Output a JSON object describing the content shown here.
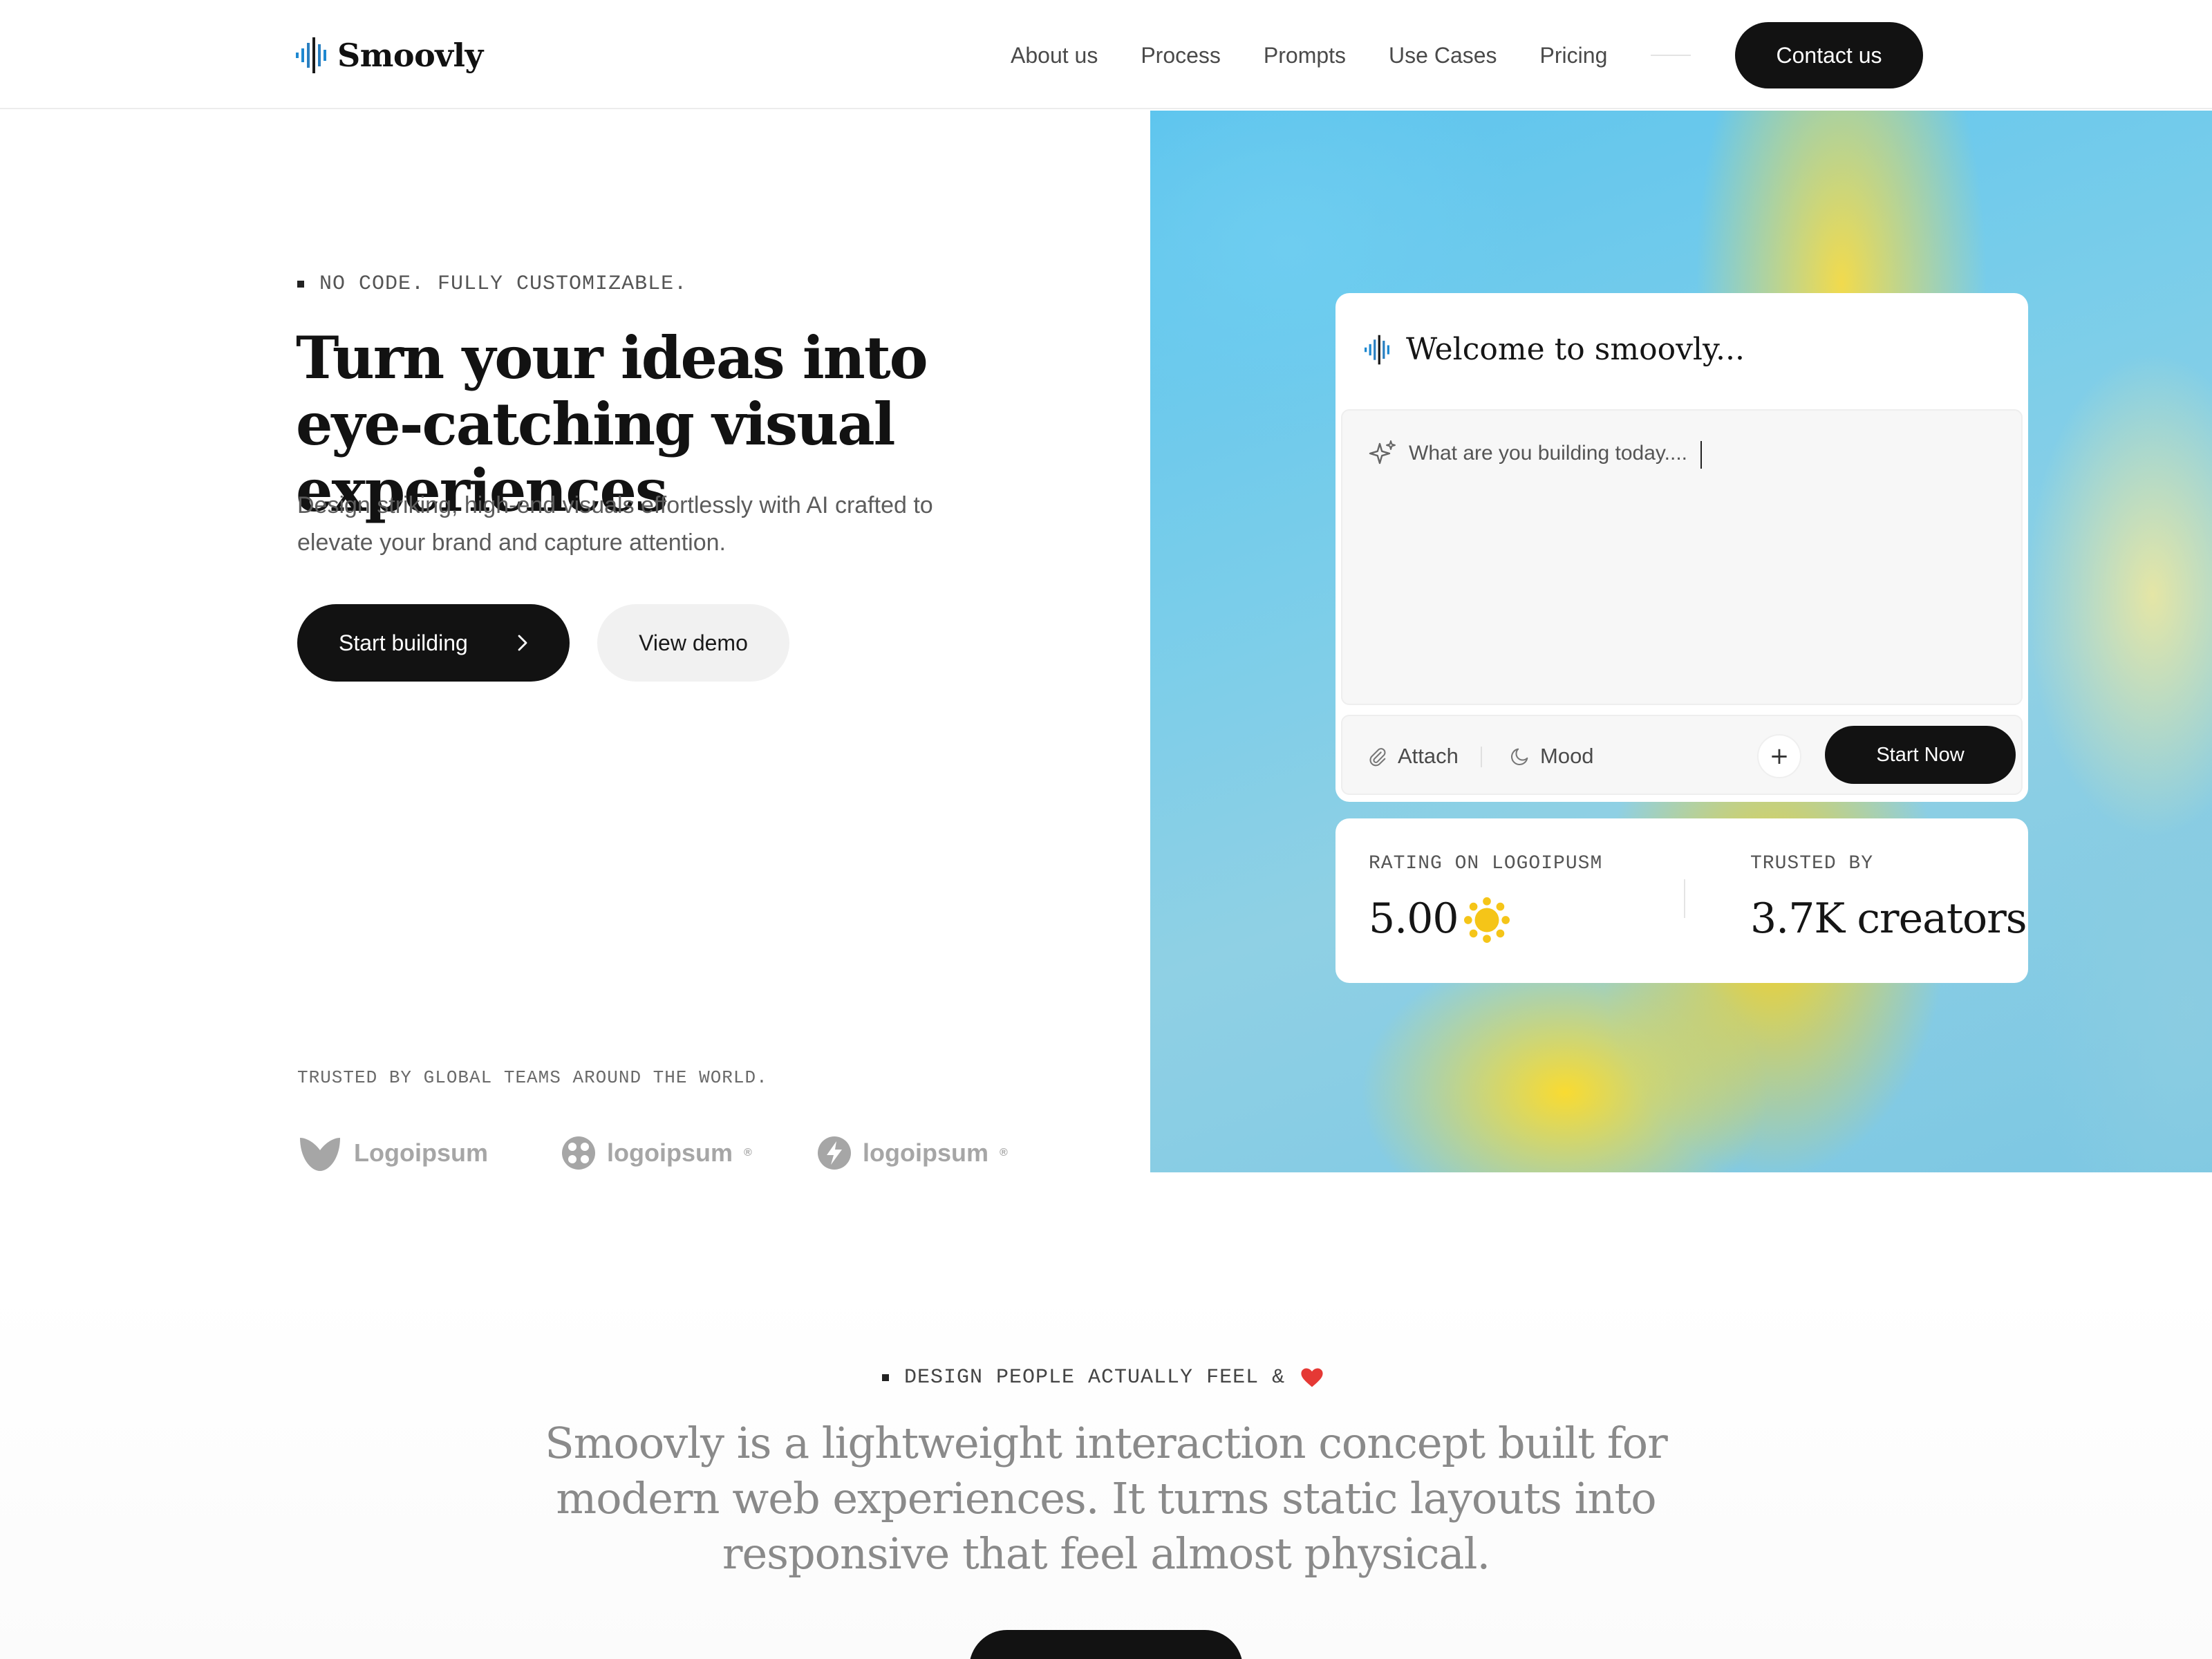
{
  "brand": {
    "name": "Smoovly"
  },
  "nav": {
    "items": [
      "About us",
      "Process",
      "Prompts",
      "Use Cases",
      "Pricing"
    ],
    "contact_label": "Contact us"
  },
  "hero": {
    "eyebrow": "NO CODE. FULLY CUSTOMIZABLE.",
    "title": "Turn your ideas into eye-catching visual experiences",
    "subtitle": "Design striking, high-end visuals effortlessly with AI crafted to elevate your brand and capture attention.",
    "primary_button": "Start building",
    "secondary_button": "View demo",
    "trusted_label": "TRUSTED BY GLOBAL TEAMS AROUND THE WORLD.",
    "partners": [
      "Logoipsum",
      "logoipsum",
      "logoipsum"
    ]
  },
  "prompt_card": {
    "welcome": "Welcome to smoovly...",
    "placeholder": "What are you building today....",
    "attach_label": "Attach",
    "mood_label": "Mood",
    "plus_label": "+",
    "start_label": "Start Now"
  },
  "stats": {
    "rating_label": "RATING ON LOGOIPUSM",
    "rating_value": "5.00",
    "trusted_label": "TRUSTED BY",
    "trusted_value": "3.7K creators"
  },
  "about": {
    "eyebrow": "DESIGN PEOPLE ACTUALLY FEEL &",
    "statement": "Smoovly is a lightweight interaction concept built for modern web experiences. It turns static layouts into responsive that feel almost physical."
  },
  "icons": {
    "logo": "sound-wave-icon",
    "sparkle": "sparkle-icon",
    "attach": "paperclip-icon",
    "mood": "moon-icon",
    "chevron": "chevron-right-icon",
    "sun": "sun-icon",
    "heart": "heart-icon"
  },
  "colors": {
    "primary": "#121212",
    "logo_accent": "#1e88d0",
    "sun": "#f5c518",
    "heart": "#e53935"
  }
}
